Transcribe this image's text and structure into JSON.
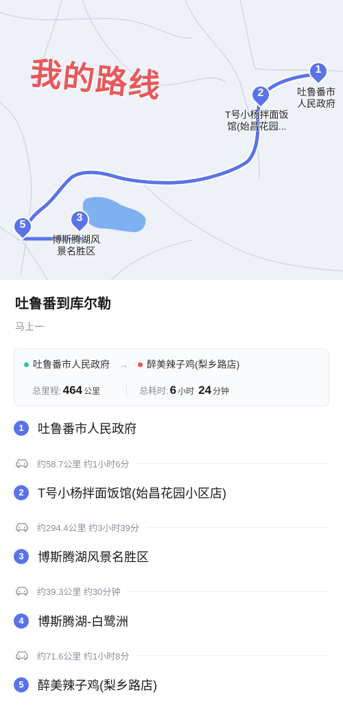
{
  "map": {
    "overlay_title": "我的路线",
    "pins": [
      {
        "num": "1",
        "label_lines": [
          "吐鲁番市",
          "人民政府"
        ]
      },
      {
        "num": "2",
        "label_lines": [
          "T号小杨拌面饭",
          "馆(始昌花园..."
        ]
      },
      {
        "num": "3",
        "label_lines": [
          "博斯腾湖风",
          "景名胜区"
        ]
      },
      {
        "num": "5",
        "label_lines": []
      }
    ],
    "colors": {
      "route": "#5a73e8",
      "lake": "#7fb0f2",
      "title": "#e8585a"
    }
  },
  "trip": {
    "title": "吐鲁番到库尔勒",
    "subtitle": "马上一",
    "origin": "吐鲁番市人民政府",
    "destination": "醉美辣子鸡(梨乡路店)",
    "distance_label": "总里程:",
    "distance_value": "464",
    "distance_unit": "公里",
    "duration_label": "总耗时:",
    "duration_hours": "6",
    "duration_hours_unit": "小时",
    "duration_minutes": "24",
    "duration_minutes_unit": "分钟"
  },
  "stops": [
    {
      "num": "1",
      "name": "吐鲁番市人民政府"
    },
    {
      "num": "2",
      "name": "T号小杨拌面饭馆(始昌花园小区店)"
    },
    {
      "num": "3",
      "name": "博斯腾湖风景名胜区"
    },
    {
      "num": "4",
      "name": "博斯腾湖-白鹭洲"
    },
    {
      "num": "5",
      "name": "醉美辣子鸡(梨乡路店)"
    }
  ],
  "legs": [
    {
      "text": "约58.7公里 约1小时6分",
      "icon": "car-icon"
    },
    {
      "text": "约294.4公里 约3小时39分",
      "icon": "car-icon"
    },
    {
      "text": "约39.3公里 约30分钟",
      "icon": "car-icon"
    },
    {
      "text": "约71.6公里 约1小时8分",
      "icon": "car-icon"
    }
  ]
}
